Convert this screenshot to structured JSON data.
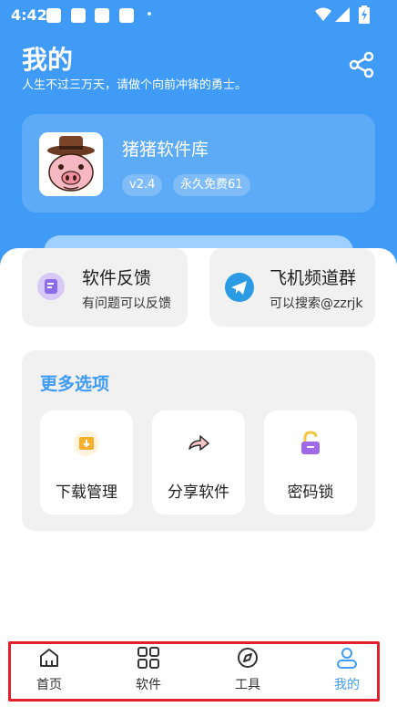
{
  "status_bar": {
    "time": "4:42"
  },
  "header": {
    "title": "我的",
    "subtitle": "人生不过三万天，请做个向前冲锋的勇士。"
  },
  "app_info": {
    "name": "猪猪软件库",
    "version": "v2.4",
    "license": "永久免费61"
  },
  "quick_actions": [
    {
      "title": "软件反馈",
      "subtitle": "有问题可以反馈",
      "icon": "feedback-icon"
    },
    {
      "title": "飞机频道群",
      "subtitle": "可以搜索@zzrjk",
      "icon": "telegram-icon"
    }
  ],
  "more_options": {
    "title": "更多选项",
    "items": [
      {
        "label": "下载管理",
        "icon": "download-folder-icon"
      },
      {
        "label": "分享软件",
        "icon": "share-arrow-icon"
      },
      {
        "label": "密码锁",
        "icon": "padlock-icon"
      }
    ]
  },
  "bottom_nav": {
    "items": [
      {
        "label": "首页",
        "icon": "home-icon"
      },
      {
        "label": "软件",
        "icon": "grid-icon"
      },
      {
        "label": "工具",
        "icon": "compass-icon"
      },
      {
        "label": "我的",
        "icon": "user-icon"
      }
    ],
    "active_index": 3
  },
  "colors": {
    "primary": "#3f9bf6",
    "highlight_outline": "#e0202a"
  }
}
